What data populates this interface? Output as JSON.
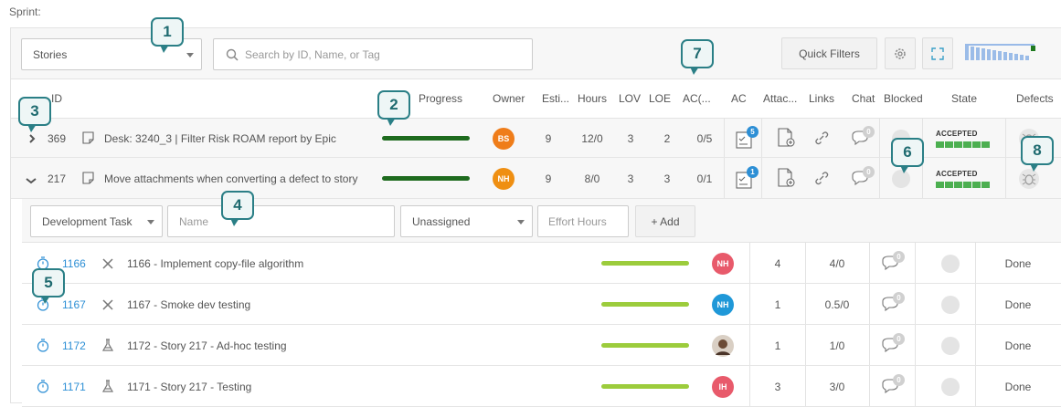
{
  "sprint_label": "Sprint:",
  "toolbar": {
    "type_select": "Stories",
    "search_placeholder": "Search by ID, Name, or Tag",
    "quick_filters": "Quick Filters"
  },
  "columns": {
    "id": "ID",
    "progress": "Progress",
    "owner": "Owner",
    "estimate": "Esti...",
    "hours": "Hours",
    "lov": "LOV",
    "loe": "LOE",
    "ac_count": "AC(...",
    "ac": "AC",
    "attachments": "Attac...",
    "links": "Links",
    "chat": "Chat",
    "blocked": "Blocked",
    "state": "State",
    "defects": "Defects"
  },
  "stories": [
    {
      "id": "369",
      "name": "Desk: 3240_3 | Filter Risk ROAM report by Epic",
      "owner": "BS",
      "estimate": "9",
      "hours": "12/0",
      "lov": "3",
      "loe": "2",
      "ac_count": "0/5",
      "ac_badge": "5",
      "chat_badge": "0",
      "state": "ACCEPTED",
      "progress": 1.0
    },
    {
      "id": "217",
      "name": "Move attachments when converting a defect to story",
      "owner": "NH",
      "estimate": "9",
      "hours": "8/0",
      "lov": "3",
      "loe": "3",
      "ac_count": "0/1",
      "ac_badge": "1",
      "chat_badge": "0",
      "state": "ACCEPTED",
      "progress": 1.0
    }
  ],
  "task_form": {
    "type": "Development Task",
    "name_placeholder": "Name",
    "assignee": "Unassigned",
    "effort_placeholder": "Effort Hours",
    "add_button": "+ Add"
  },
  "tasks": [
    {
      "id": "1166",
      "name": "1166 - Implement copy-file algorithm",
      "owner": "NH",
      "estimate": "4",
      "hours": "4/0",
      "chat_badge": "0",
      "status": "Done",
      "progress": 1.0
    },
    {
      "id": "1167",
      "name": "1167 - Smoke dev testing",
      "owner": "NH",
      "estimate": "1",
      "hours": "0.5/0",
      "chat_badge": "0",
      "status": "Done",
      "progress": 1.0
    },
    {
      "id": "1172",
      "name": "1172 - Story 217 - Ad-hoc testing",
      "owner": "",
      "estimate": "1",
      "hours": "1/0",
      "chat_badge": "0",
      "status": "Done",
      "progress": 1.0
    },
    {
      "id": "1171",
      "name": "1171 - Story 217 - Testing",
      "owner": "IH",
      "estimate": "3",
      "hours": "3/0",
      "chat_badge": "0",
      "status": "Done",
      "progress": 1.0
    }
  ],
  "callouts": [
    "1",
    "2",
    "3",
    "4",
    "5",
    "6",
    "7",
    "8"
  ],
  "colors": {
    "story_progress": "#1e6b1e",
    "task_progress": "#9ccc3c",
    "accepted_green": "#4caf50",
    "link_blue": "#2d8fd5",
    "avatar_bs": "#ef7d1a",
    "avatar_nh_story": "#ef8f12",
    "avatar_nh_task_red": "#e85a6b",
    "avatar_nh_task_blue": "#1f98d8",
    "avatar_ih": "#e85a6b",
    "callout": "#2a7f86"
  },
  "icons": [
    "search-icon",
    "gear-icon",
    "expand-icon",
    "chevron-right-icon",
    "chevron-down-icon",
    "story-icon",
    "checklist-icon",
    "attachment-icon",
    "link-icon",
    "chat-icon",
    "bug-icon",
    "stopwatch-icon",
    "task-icon",
    "test-flask-icon"
  ]
}
